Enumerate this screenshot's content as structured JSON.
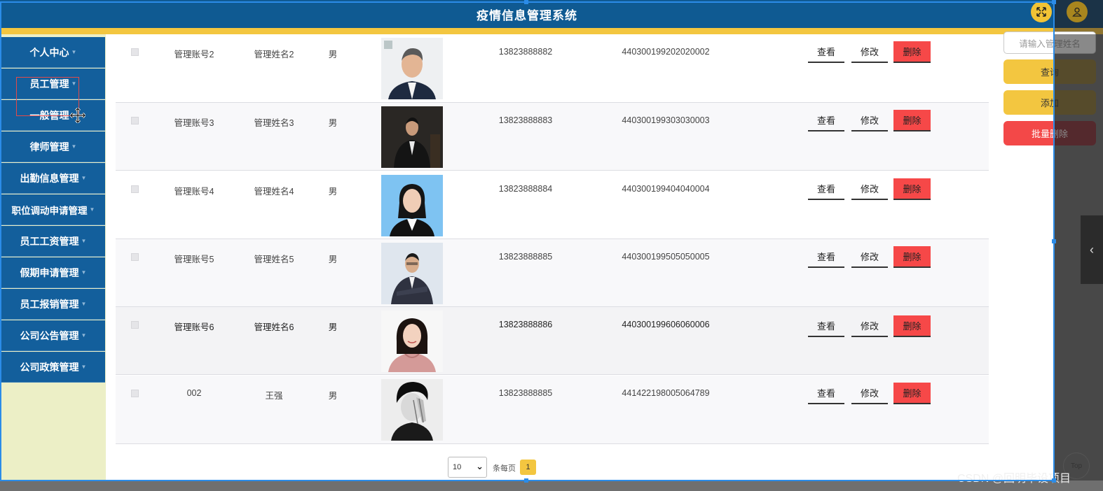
{
  "header": {
    "title": "疫情信息管理系统"
  },
  "sidebar": {
    "items": [
      {
        "label": "个人中心"
      },
      {
        "label": "员工管理"
      },
      {
        "label": "一般管理"
      },
      {
        "label": "律师管理"
      },
      {
        "label": "出勤信息管理"
      },
      {
        "label": "职位调动申请管理"
      },
      {
        "label": "员工工资管理"
      },
      {
        "label": "假期申请管理"
      },
      {
        "label": "员工报销管理"
      },
      {
        "label": "公司公告管理"
      },
      {
        "label": "公司政策管理"
      }
    ]
  },
  "table": {
    "rows": [
      {
        "account": "管理账号2",
        "name": "管理姓名2",
        "sex": "男",
        "phone": "13823888882",
        "id_number": "440300199202020002"
      },
      {
        "account": "管理账号3",
        "name": "管理姓名3",
        "sex": "男",
        "phone": "13823888883",
        "id_number": "440300199303030003"
      },
      {
        "account": "管理账号4",
        "name": "管理姓名4",
        "sex": "男",
        "phone": "13823888884",
        "id_number": "440300199404040004"
      },
      {
        "account": "管理账号5",
        "name": "管理姓名5",
        "sex": "男",
        "phone": "13823888885",
        "id_number": "440300199505050005"
      },
      {
        "account": "管理账号6",
        "name": "管理姓名6",
        "sex": "男",
        "phone": "13823888886",
        "id_number": "440300199606060006"
      },
      {
        "account": "002",
        "name": "王强",
        "sex": "男",
        "phone": "13823888885",
        "id_number": "441422198005064789"
      }
    ],
    "actions": {
      "view": "查看",
      "edit": "修改",
      "delete": "删除"
    }
  },
  "pagination": {
    "page_size": "10",
    "per_page_label": "条每页",
    "current_page": "1"
  },
  "controls": {
    "search_placeholder": "请输入管理姓名",
    "query": "查询",
    "add": "添加",
    "batch_delete": "批量删除"
  },
  "misc": {
    "top_label": "Top",
    "watermark": "CSDN @回明毕设项目"
  },
  "colors": {
    "header_bg": "#0f5a92",
    "accent_yellow": "#f3c640",
    "danger_red": "#f64848",
    "sidebar_bg": "#135f9c"
  }
}
